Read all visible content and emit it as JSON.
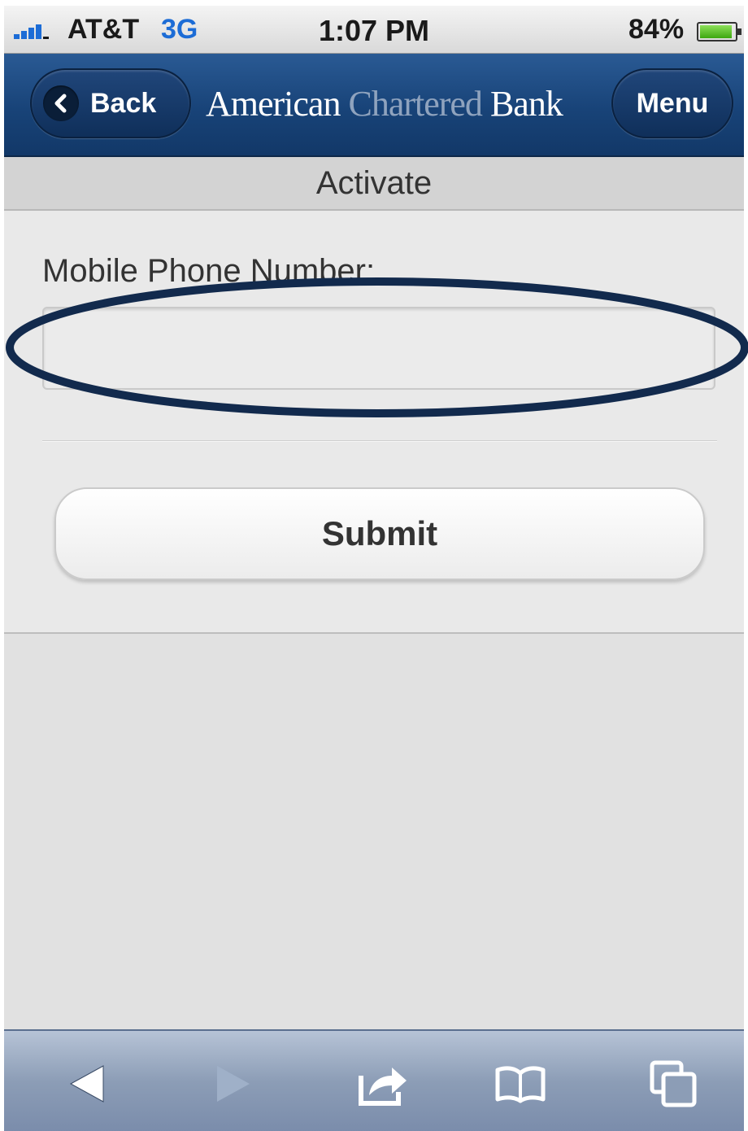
{
  "status_bar": {
    "carrier": "AT&T",
    "network": "3G",
    "time": "1:07 PM",
    "battery": "84%",
    "battery_level": 0.84
  },
  "header": {
    "back_label": "Back",
    "menu_label": "Menu",
    "logo_word1": "American",
    "logo_word2": "Chartered",
    "logo_word3": "Bank"
  },
  "page": {
    "title": "Activate"
  },
  "form": {
    "phone_label": "Mobile Phone Number:",
    "phone_value": "",
    "phone_placeholder": "",
    "submit_label": "Submit"
  },
  "toolbar": {
    "icons": [
      "back-icon",
      "forward-icon",
      "share-icon",
      "bookmarks-icon",
      "tabs-icon"
    ]
  },
  "annotation": {
    "color": "#122a4d"
  }
}
